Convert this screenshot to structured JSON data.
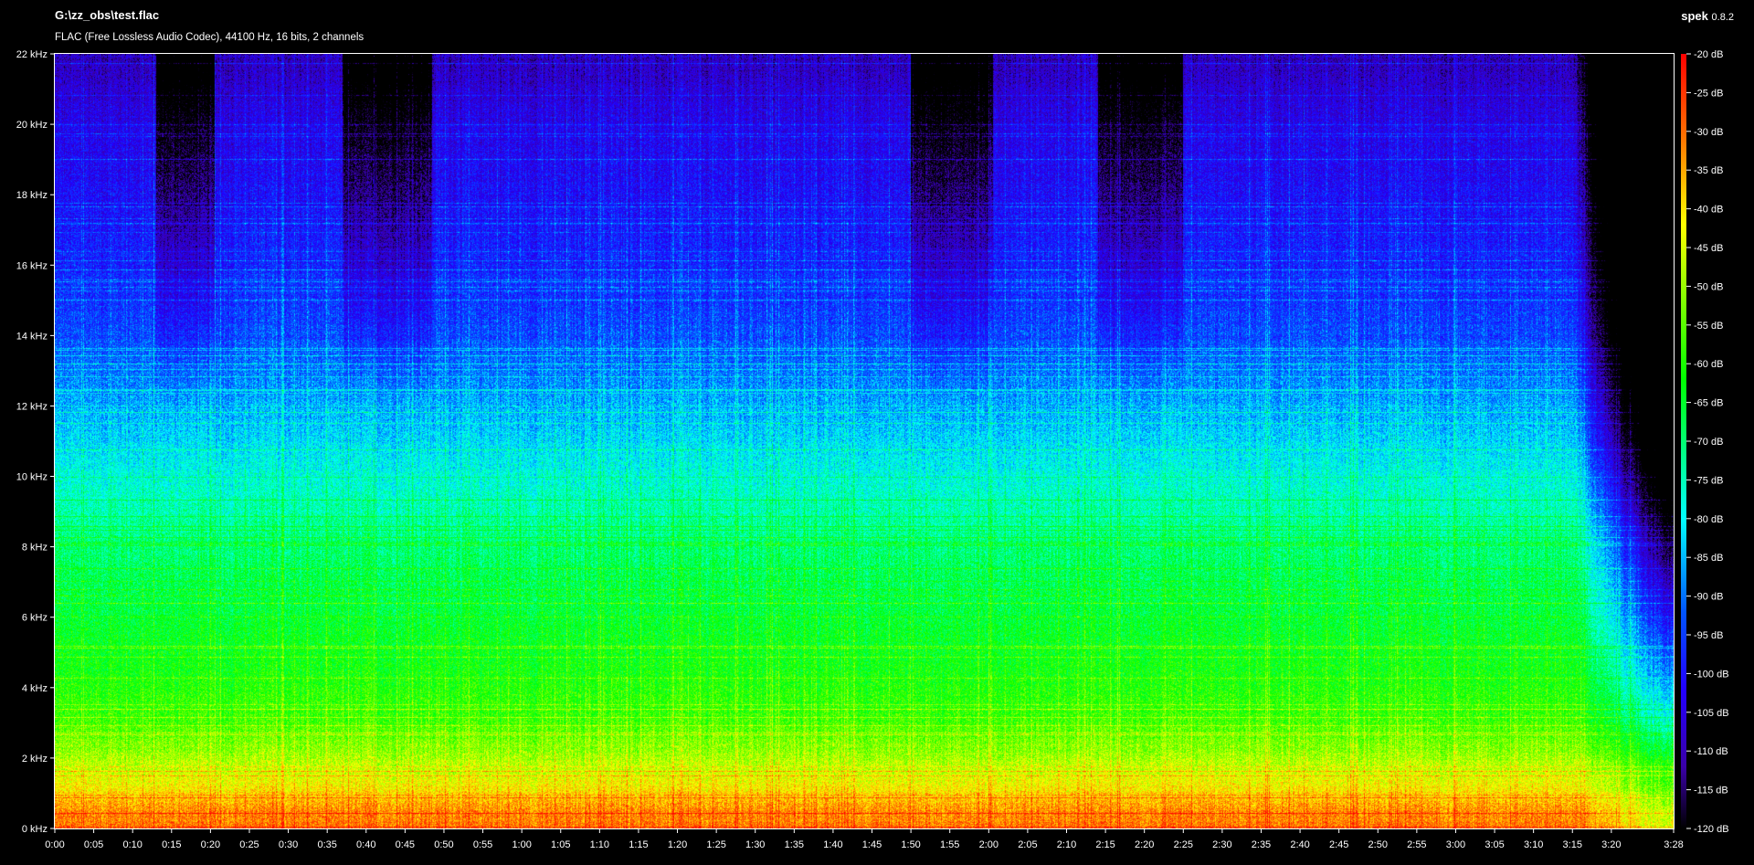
{
  "header": {
    "file_path": "G:\\zz_obs\\test.flac",
    "file_info": "FLAC (Free Lossless Audio Codec), 44100 Hz, 16 bits, 2 channels",
    "app_name": "spek",
    "app_version": "0.8.2"
  },
  "chart_data": {
    "type": "heatmap",
    "title": "",
    "xlabel": "",
    "ylabel": "",
    "x_unit": "seconds",
    "x_range": [
      0,
      208
    ],
    "x_ticks": [
      "0:00",
      "0:05",
      "0:10",
      "0:15",
      "0:20",
      "0:25",
      "0:30",
      "0:35",
      "0:40",
      "0:45",
      "0:50",
      "0:55",
      "1:00",
      "1:05",
      "1:10",
      "1:15",
      "1:20",
      "1:25",
      "1:30",
      "1:35",
      "1:40",
      "1:45",
      "1:50",
      "1:55",
      "2:00",
      "2:05",
      "2:10",
      "2:15",
      "2:20",
      "2:25",
      "2:30",
      "2:35",
      "2:40",
      "2:45",
      "2:50",
      "2:55",
      "3:00",
      "3:05",
      "3:10",
      "3:15",
      "3:20",
      "3:28"
    ],
    "y_unit": "kHz",
    "y_range": [
      0,
      22
    ],
    "y_ticks": [
      "0 kHz",
      "2 kHz",
      "4 kHz",
      "6 kHz",
      "8 kHz",
      "10 kHz",
      "12 kHz",
      "14 kHz",
      "16 kHz",
      "18 kHz",
      "20 kHz",
      "22 kHz"
    ],
    "colorbar": {
      "unit": "dB",
      "range": [
        -120,
        -20
      ],
      "ticks": [
        "-20 dB",
        "-25 dB",
        "-30 dB",
        "-35 dB",
        "-40 dB",
        "-45 dB",
        "-50 dB",
        "-55 dB",
        "-60 dB",
        "-65 dB",
        "-70 dB",
        "-75 dB",
        "-80 dB",
        "-85 dB",
        "-90 dB",
        "-95 dB",
        "-100 dB",
        "-105 dB",
        "-110 dB",
        "-115 dB",
        "-120 dB"
      ],
      "stops": [
        {
          "db": -20,
          "color": "#ff0000"
        },
        {
          "db": -30,
          "color": "#ff6a00"
        },
        {
          "db": -42,
          "color": "#ffff00"
        },
        {
          "db": -62,
          "color": "#00ff00"
        },
        {
          "db": -80,
          "color": "#00ffff"
        },
        {
          "db": -92,
          "color": "#0055ff"
        },
        {
          "db": -102,
          "color": "#2200ff"
        },
        {
          "db": -112,
          "color": "#3a00a8"
        },
        {
          "db": -120,
          "color": "#000000"
        }
      ]
    },
    "frequency_profile_db": [
      {
        "khz": 0,
        "db": -30
      },
      {
        "khz": 0.5,
        "db": -33
      },
      {
        "khz": 1.5,
        "db": -45
      },
      {
        "khz": 3,
        "db": -57
      },
      {
        "khz": 5,
        "db": -63
      },
      {
        "khz": 8,
        "db": -70
      },
      {
        "khz": 10,
        "db": -78
      },
      {
        "khz": 12,
        "db": -86
      },
      {
        "khz": 14,
        "db": -94
      },
      {
        "khz": 17,
        "db": -100
      },
      {
        "khz": 20,
        "db": -104
      },
      {
        "khz": 22,
        "db": -110
      }
    ],
    "quiet_high_band_segments": [
      {
        "start": 13,
        "end": 20.5
      },
      {
        "start": 37,
        "end": 48.5
      },
      {
        "start": 110,
        "end": 120.5
      },
      {
        "start": 134,
        "end": 145
      }
    ],
    "fade_out_start_s": 195,
    "fade_out_end_s": 208
  }
}
